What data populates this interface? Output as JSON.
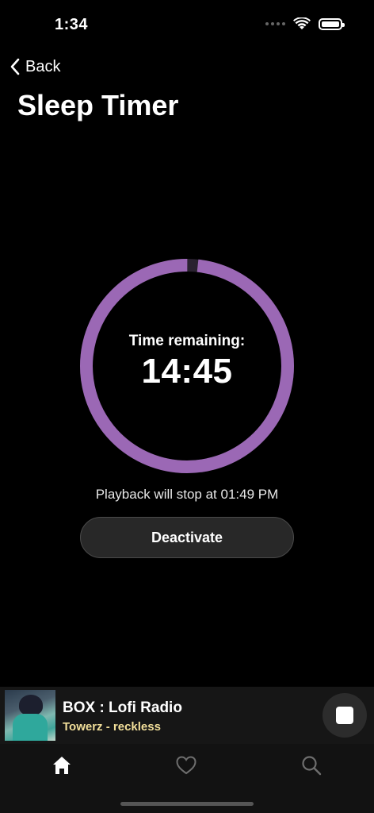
{
  "status_bar": {
    "time": "1:34",
    "icons": [
      "signal-dots-icon",
      "wifi-icon",
      "battery-icon"
    ]
  },
  "nav": {
    "back_label": "Back",
    "back_icon": "chevron-left-icon"
  },
  "page": {
    "title": "Sleep Timer"
  },
  "timer": {
    "label": "Time remaining:",
    "value": "14:45",
    "progress_fraction": 0.983,
    "ring_color": "#9b68b5",
    "track_color": "#2a2230"
  },
  "stop_info": "Playback will stop at 01:49 PM",
  "deactivate_label": "Deactivate",
  "mini_player": {
    "title": "BOX : Lofi Radio",
    "artist": "Towerz - reckless",
    "artist_color": "#f2df9a",
    "stop_icon": "stop-icon"
  },
  "tabs": [
    {
      "name": "home",
      "icon": "home-icon",
      "active": true
    },
    {
      "name": "favorites",
      "icon": "heart-icon",
      "active": false
    },
    {
      "name": "search",
      "icon": "search-icon",
      "active": false
    }
  ]
}
